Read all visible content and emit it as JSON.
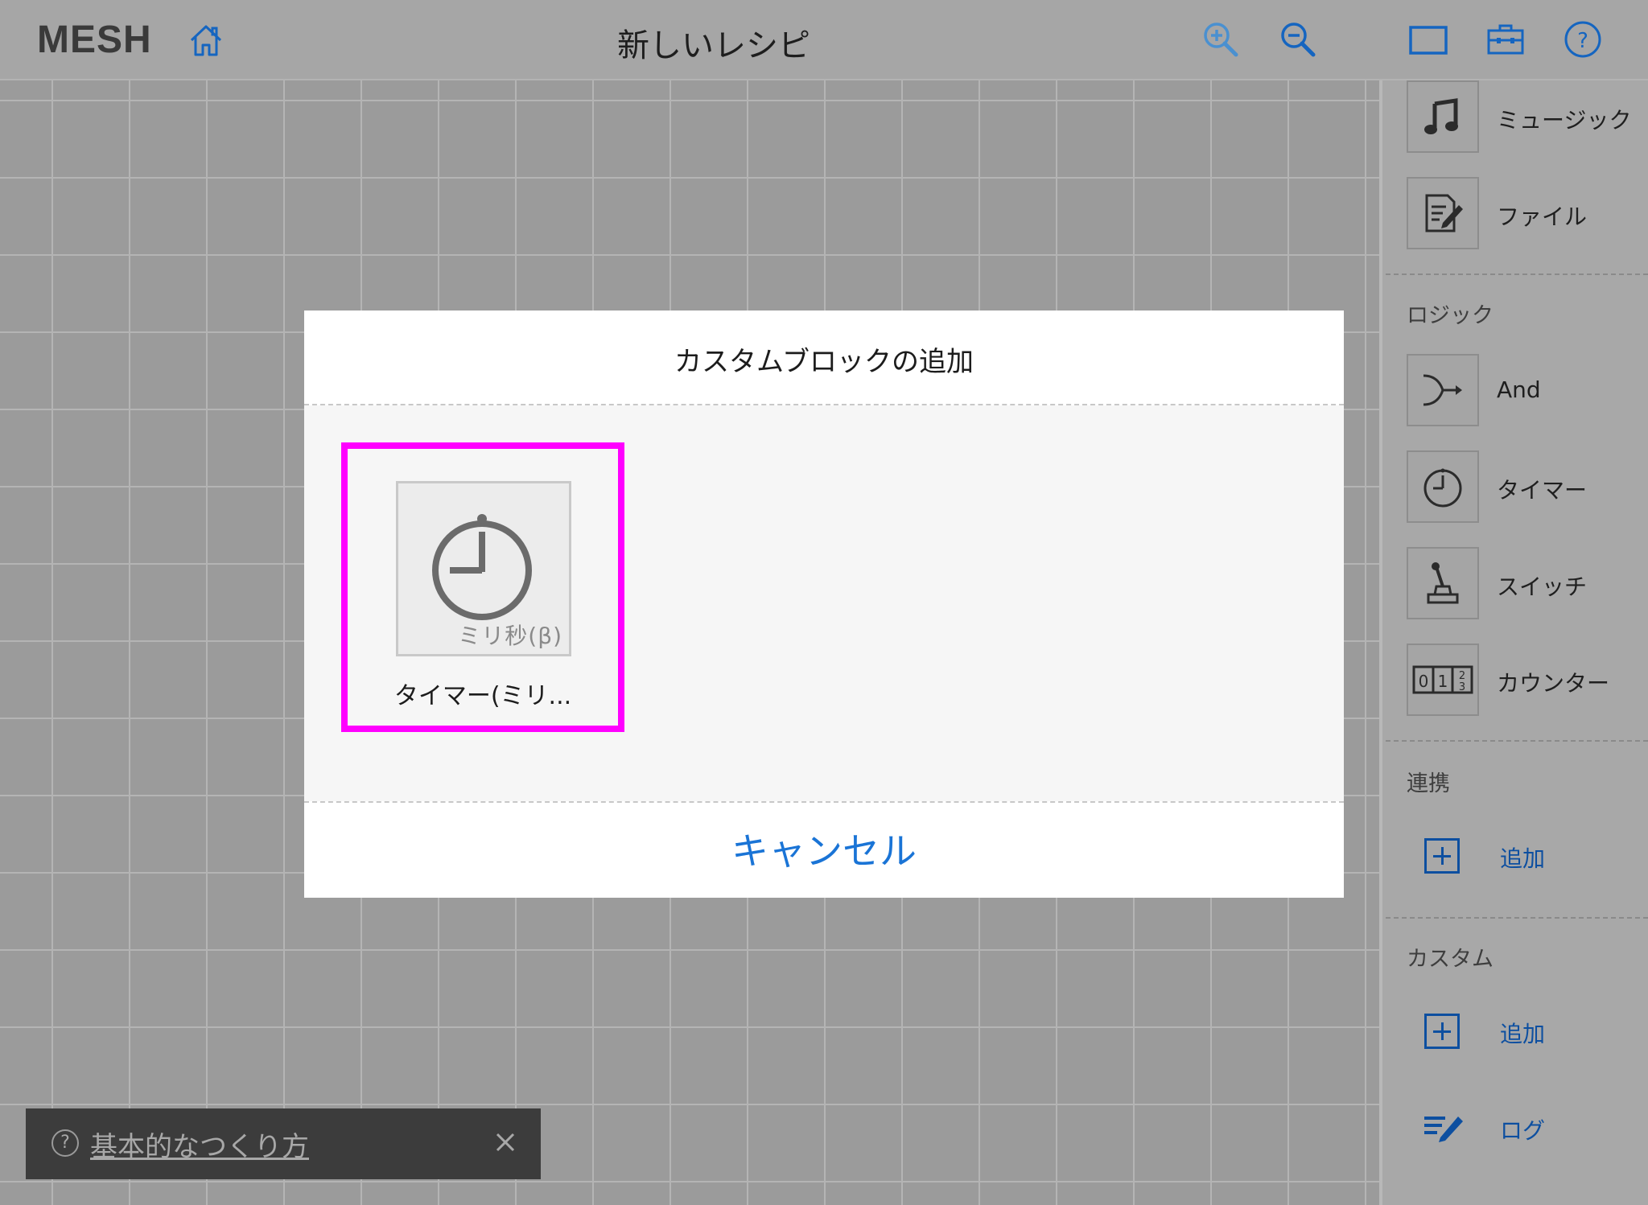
{
  "header": {
    "logo": "MESH",
    "title": "新しいレシピ",
    "icons": [
      "home-icon",
      "zoom-in-icon",
      "zoom-out-icon",
      "window-icon",
      "toolbox-icon",
      "help-icon"
    ]
  },
  "sidebar": {
    "items_top": [
      {
        "label": "ミュージック",
        "icon": "music-note-icon"
      },
      {
        "label": "ファイル",
        "icon": "file-edit-icon"
      }
    ],
    "logic": {
      "title": "ロジック",
      "items": [
        {
          "label": "And",
          "icon": "and-merge-icon"
        },
        {
          "label": "タイマー",
          "icon": "timer-icon"
        },
        {
          "label": "スイッチ",
          "icon": "switch-lever-icon"
        },
        {
          "label": "カウンター",
          "icon": "counter-icon"
        }
      ]
    },
    "integration": {
      "title": "連携",
      "add_label": "追加"
    },
    "custom": {
      "title": "カスタム",
      "add_label": "追加"
    },
    "log": {
      "label": "ログ",
      "icon": "log-pen-icon"
    },
    "counter_digits": [
      "0",
      "1",
      "2",
      "3"
    ]
  },
  "dialog": {
    "title": "カスタムブロックの追加",
    "block": {
      "label": "タイマー(ミリ...",
      "badge": "ミリ秒(β)",
      "icon": "timer-icon"
    },
    "cancel_label": "キャンセル"
  },
  "toast": {
    "help_glyph": "?",
    "link_text": "基本的なつくり方",
    "close_icon": "close-icon"
  },
  "colors": {
    "accent": "#1a74d6",
    "sidebar_link": "#0d4fa0",
    "highlight": "#ff00ff"
  }
}
